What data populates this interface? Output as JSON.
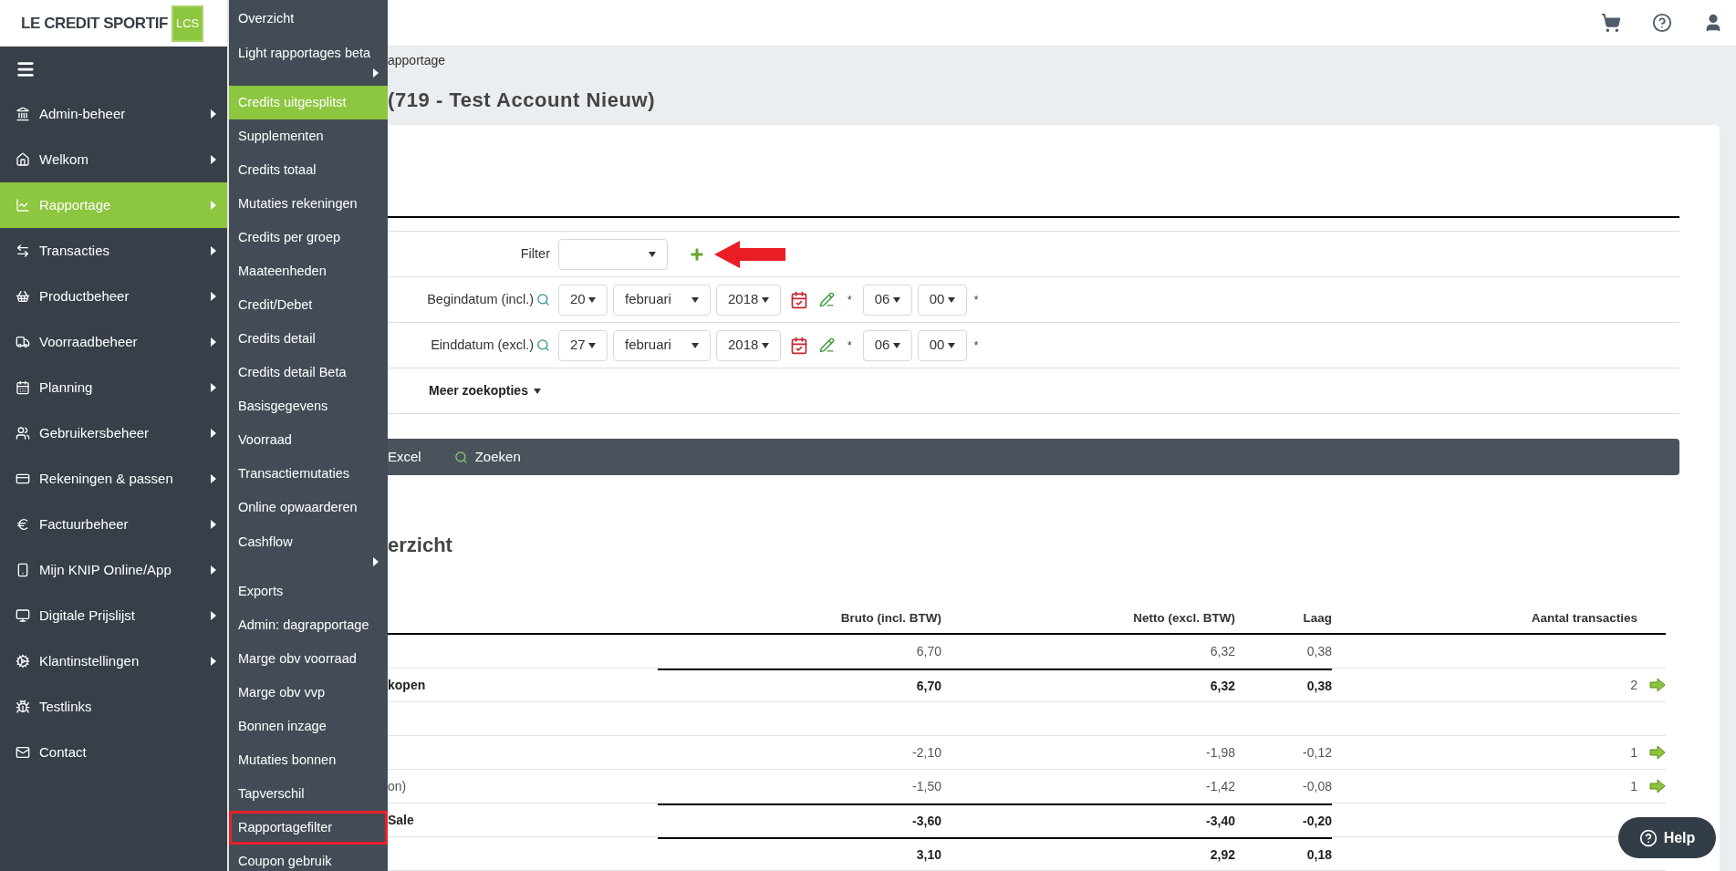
{
  "logo": {
    "text": "LE CREDIT SPORTIF",
    "badge": "LCS"
  },
  "sidebar": {
    "items": [
      {
        "label": "Admin-beheer",
        "selected": false,
        "has_submenu": true
      },
      {
        "label": "Welkom",
        "selected": false,
        "has_submenu": true
      },
      {
        "label": "Rapportage",
        "selected": true,
        "has_submenu": true
      },
      {
        "label": "Transacties",
        "selected": false,
        "has_submenu": true
      },
      {
        "label": "Productbeheer",
        "selected": false,
        "has_submenu": true
      },
      {
        "label": "Voorraadbeheer",
        "selected": false,
        "has_submenu": true
      },
      {
        "label": "Planning",
        "selected": false,
        "has_submenu": true
      },
      {
        "label": "Gebruikersbeheer",
        "selected": false,
        "has_submenu": true
      },
      {
        "label": "Rekeningen & passen",
        "selected": false,
        "has_submenu": true
      },
      {
        "label": "Factuurbeheer",
        "selected": false,
        "has_submenu": true
      },
      {
        "label": "Mijn KNIP Online/App",
        "selected": false,
        "has_submenu": true
      },
      {
        "label": "Digitale Prijslijst",
        "selected": false,
        "has_submenu": true
      },
      {
        "label": "Klantinstellingen",
        "selected": false,
        "has_submenu": true
      },
      {
        "label": "Testlinks",
        "selected": false,
        "has_submenu": false
      },
      {
        "label": "Contact",
        "selected": false,
        "has_submenu": false
      }
    ]
  },
  "submenu": {
    "items": [
      {
        "label": "Overzicht",
        "selected": false,
        "has_submenu": false,
        "highlighted": false
      },
      {
        "label": "Light rapportages beta",
        "selected": false,
        "has_submenu": true,
        "highlighted": false
      },
      {
        "label": "Credits uitgesplitst",
        "selected": true,
        "has_submenu": false,
        "highlighted": false
      },
      {
        "label": "Supplementen",
        "selected": false,
        "has_submenu": false,
        "highlighted": false
      },
      {
        "label": "Credits totaal",
        "selected": false,
        "has_submenu": false,
        "highlighted": false
      },
      {
        "label": "Mutaties rekeningen",
        "selected": false,
        "has_submenu": false,
        "highlighted": false
      },
      {
        "label": "Credits per groep",
        "selected": false,
        "has_submenu": false,
        "highlighted": false
      },
      {
        "label": "Maateenheden",
        "selected": false,
        "has_submenu": false,
        "highlighted": false
      },
      {
        "label": "Credit/Debet",
        "selected": false,
        "has_submenu": false,
        "highlighted": false
      },
      {
        "label": "Credits detail",
        "selected": false,
        "has_submenu": false,
        "highlighted": false
      },
      {
        "label": "Credits detail Beta",
        "selected": false,
        "has_submenu": false,
        "highlighted": false
      },
      {
        "label": "Basisgegevens",
        "selected": false,
        "has_submenu": false,
        "highlighted": false
      },
      {
        "label": "Voorraad",
        "selected": false,
        "has_submenu": false,
        "highlighted": false
      },
      {
        "label": "Transactiemutaties",
        "selected": false,
        "has_submenu": false,
        "highlighted": false
      },
      {
        "label": "Online opwaarderen",
        "selected": false,
        "has_submenu": false,
        "highlighted": false
      },
      {
        "label": "Cashflow",
        "selected": false,
        "has_submenu": true,
        "highlighted": false
      },
      {
        "label": "Exports",
        "selected": false,
        "has_submenu": false,
        "highlighted": false
      },
      {
        "label": "Admin: dagrapportage",
        "selected": false,
        "has_submenu": false,
        "highlighted": false
      },
      {
        "label": "Marge obv voorraad",
        "selected": false,
        "has_submenu": false,
        "highlighted": false
      },
      {
        "label": "Marge obv vvp",
        "selected": false,
        "has_submenu": false,
        "highlighted": false
      },
      {
        "label": "Bonnen inzage",
        "selected": false,
        "has_submenu": false,
        "highlighted": false
      },
      {
        "label": "Mutaties bonnen",
        "selected": false,
        "has_submenu": false,
        "highlighted": false
      },
      {
        "label": "Tapverschil",
        "selected": false,
        "has_submenu": false,
        "highlighted": false
      },
      {
        "label": "Rapportagefilter",
        "selected": false,
        "has_submenu": false,
        "highlighted": true
      },
      {
        "label": "Coupon gebruik",
        "selected": false,
        "has_submenu": false,
        "highlighted": false
      }
    ]
  },
  "breadcrumb": "apportage",
  "page_title": "(719 - Test Account Nieuw)",
  "form": {
    "filter": {
      "label": "Filter"
    },
    "dates": [
      {
        "label": "Begindatum (incl.)",
        "day": "20",
        "month": "februari",
        "year": "2018",
        "required_mark": "*",
        "hour": "06",
        "minute": "00",
        "required_mark_2": "*"
      },
      {
        "label": "Einddatum (excl.)",
        "day": "27",
        "month": "februari",
        "year": "2018",
        "required_mark": "*",
        "hour": "06",
        "minute": "00",
        "required_mark_2": "*"
      }
    ],
    "more_options": "Meer zoekopties"
  },
  "toolbar": {
    "buttons": [
      "Excel",
      "Zoeken"
    ]
  },
  "section_title": "erzicht",
  "table": {
    "columns": [
      "Bruto (incl. BTW)",
      "Netto (excl. BTW)",
      "Laag",
      "Aantal transacties"
    ],
    "rows": [
      {
        "kind": "detail",
        "bruto": "6,70",
        "netto": "6,32",
        "laag": "0,38"
      },
      {
        "kind": "total",
        "label": "kopen",
        "bruto": "6,70",
        "netto": "6,32",
        "laag": "0,38",
        "aantal": "2"
      },
      {
        "kind": "blank"
      },
      {
        "kind": "detail",
        "bruto": "-2,10",
        "netto": "-1,98",
        "laag": "-0,12",
        "aantal": "1"
      },
      {
        "kind": "detail",
        "label": "on)",
        "bruto": "-1,50",
        "netto": "-1,42",
        "laag": "-0,08",
        "aantal": "1"
      },
      {
        "kind": "total",
        "label": "Sale",
        "bruto": "-3,60",
        "netto": "-3,40",
        "laag": "-0,20"
      },
      {
        "kind": "total",
        "bruto": "3,10",
        "netto": "2,92",
        "laag": "0,18"
      }
    ]
  },
  "help_button": "Help"
}
